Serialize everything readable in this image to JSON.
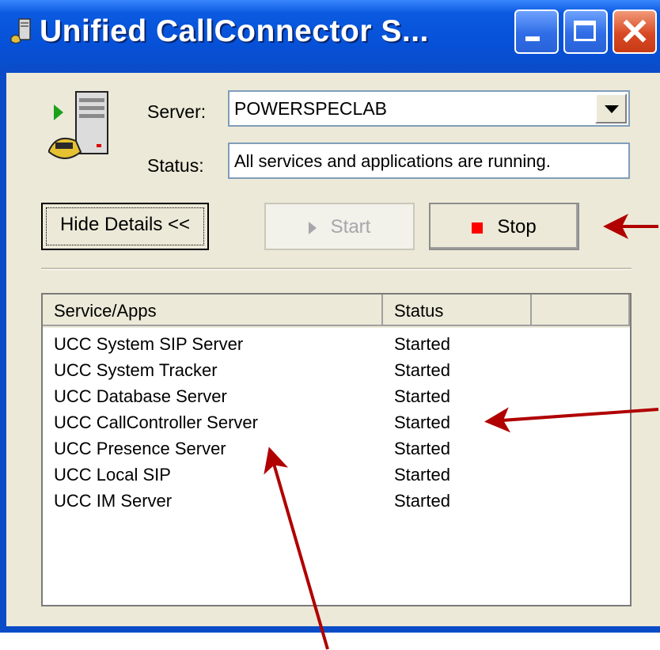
{
  "window": {
    "title": "Unified CallConnector S...",
    "title_icon": "phone-server-icon",
    "controls": [
      "minimize",
      "maximize",
      "close"
    ]
  },
  "server": {
    "label": "Server:",
    "value": "POWERSPECLAB"
  },
  "status": {
    "label": "Status:",
    "value": "All services and applications are running."
  },
  "buttons": {
    "hide_details": "Hide Details <<",
    "start": "Start",
    "stop": "Stop"
  },
  "table": {
    "columns": [
      "Service/Apps",
      "Status",
      ""
    ],
    "rows": [
      {
        "name": "UCC System SIP Server",
        "status": "Started"
      },
      {
        "name": "UCC System Tracker",
        "status": "Started"
      },
      {
        "name": "UCC Database Server",
        "status": "Started"
      },
      {
        "name": "UCC CallController Server",
        "status": "Started"
      },
      {
        "name": "UCC Presence Server",
        "status": "Started"
      },
      {
        "name": "UCC Local SIP",
        "status": "Started"
      },
      {
        "name": "UCC IM Server",
        "status": "Started"
      }
    ]
  },
  "colors": {
    "titlebar": "#0a4cc8",
    "window_bg": "#ece9d8",
    "annotation_arrow": "#b00000",
    "stop_icon": "#ff0000"
  }
}
